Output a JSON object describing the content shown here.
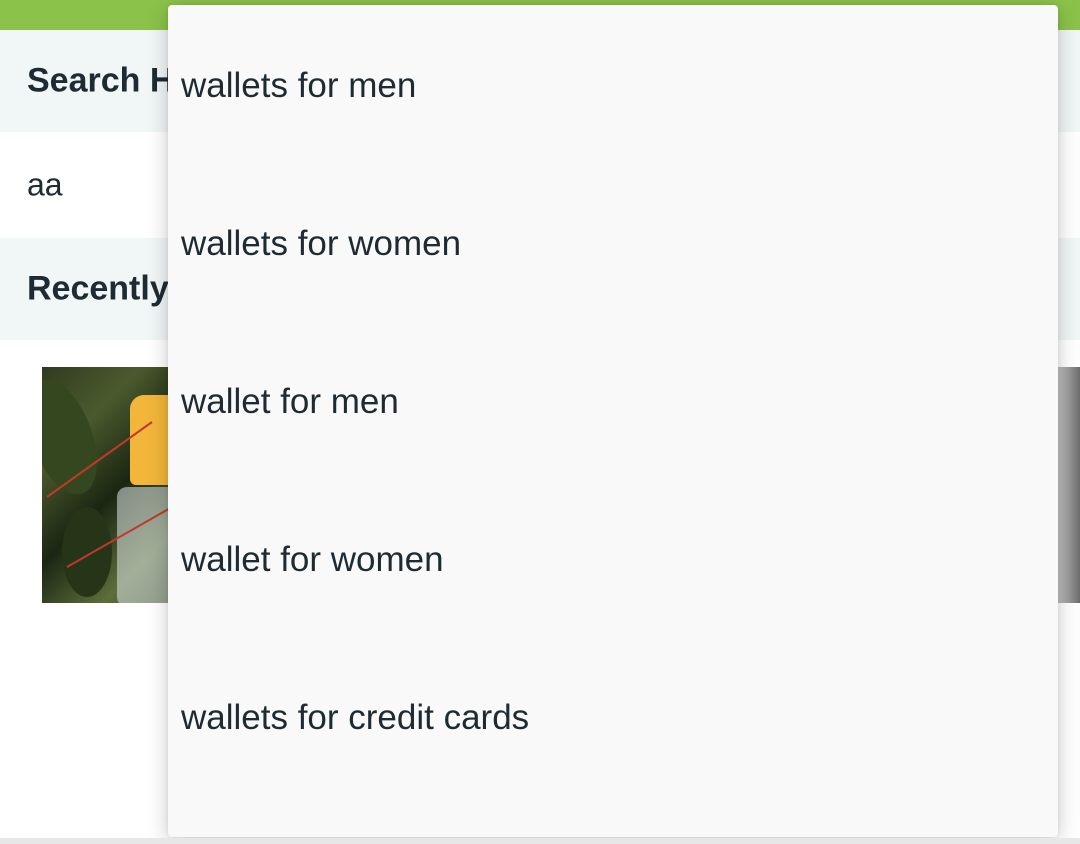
{
  "search_history": {
    "title": "Search History",
    "items": [
      "aa"
    ]
  },
  "recently_viewed": {
    "title": "Recently Viewed"
  },
  "suggestions": [
    "wallets for men",
    "wallets for women",
    "wallet for men",
    "wallet for women",
    "wallets for credit cards"
  ],
  "colors": {
    "accent": "#8bc34a",
    "section_bg": "#f1f6f6",
    "text": "#1e2b33",
    "dropdown_bg": "#f9f9f9"
  }
}
